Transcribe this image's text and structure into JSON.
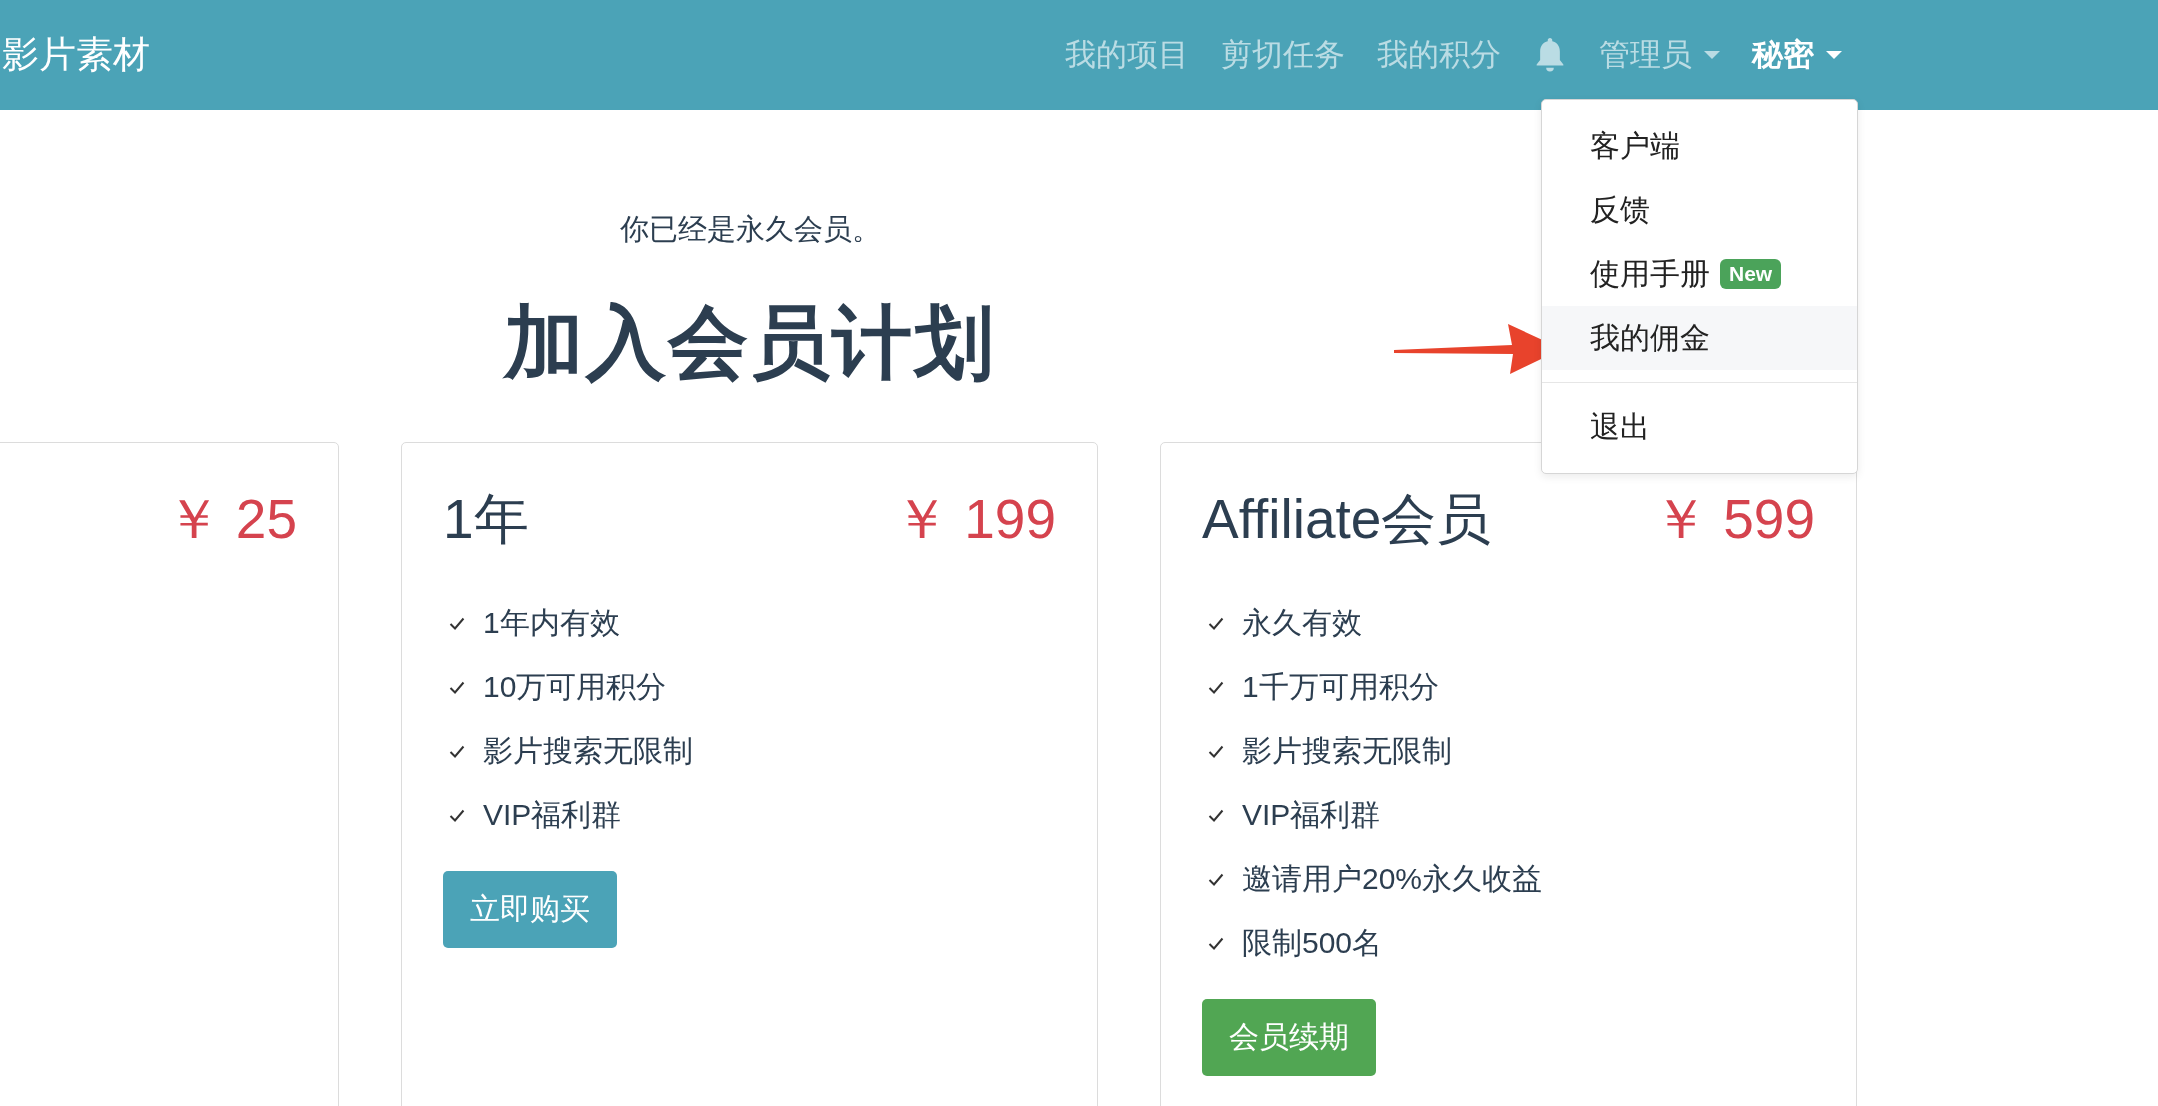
{
  "navbar": {
    "brand": "影片素材",
    "links": [
      {
        "label": "我的项目"
      },
      {
        "label": "剪切任务"
      },
      {
        "label": "我的积分"
      }
    ],
    "dropdowns": [
      {
        "label": "管理员",
        "expanded": false
      },
      {
        "label": "秘密",
        "expanded": true,
        "menu": [
          {
            "items": [
              {
                "label": "客户端",
                "selected": false
              },
              {
                "label": "反馈",
                "selected": false
              },
              {
                "label": "使用手册",
                "badge": "New",
                "selected": false
              },
              {
                "label": "我的佣金",
                "selected": true
              }
            ]
          },
          {
            "items": [
              {
                "label": "退出",
                "selected": false
              }
            ]
          }
        ]
      }
    ]
  },
  "notice": "你已经是永久会员。",
  "heading": "加入会员计划",
  "plans": [
    {
      "price": "￥ 25"
    },
    {
      "title": "1年",
      "price": "￥ 199",
      "features": [
        "1年内有效",
        "10万可用积分",
        "影片搜索无限制",
        "VIP福利群"
      ],
      "button": {
        "label": "立即购买",
        "kind": "primary"
      }
    },
    {
      "title": "Affiliate会员",
      "price": "￥ 599",
      "features": [
        "永久有效",
        "1千万可用积分",
        "影片搜索无限制",
        "VIP福利群",
        "邀请用户20%永久收益",
        "限制500名"
      ],
      "button": {
        "label": "会员续期",
        "kind": "success"
      }
    }
  ]
}
